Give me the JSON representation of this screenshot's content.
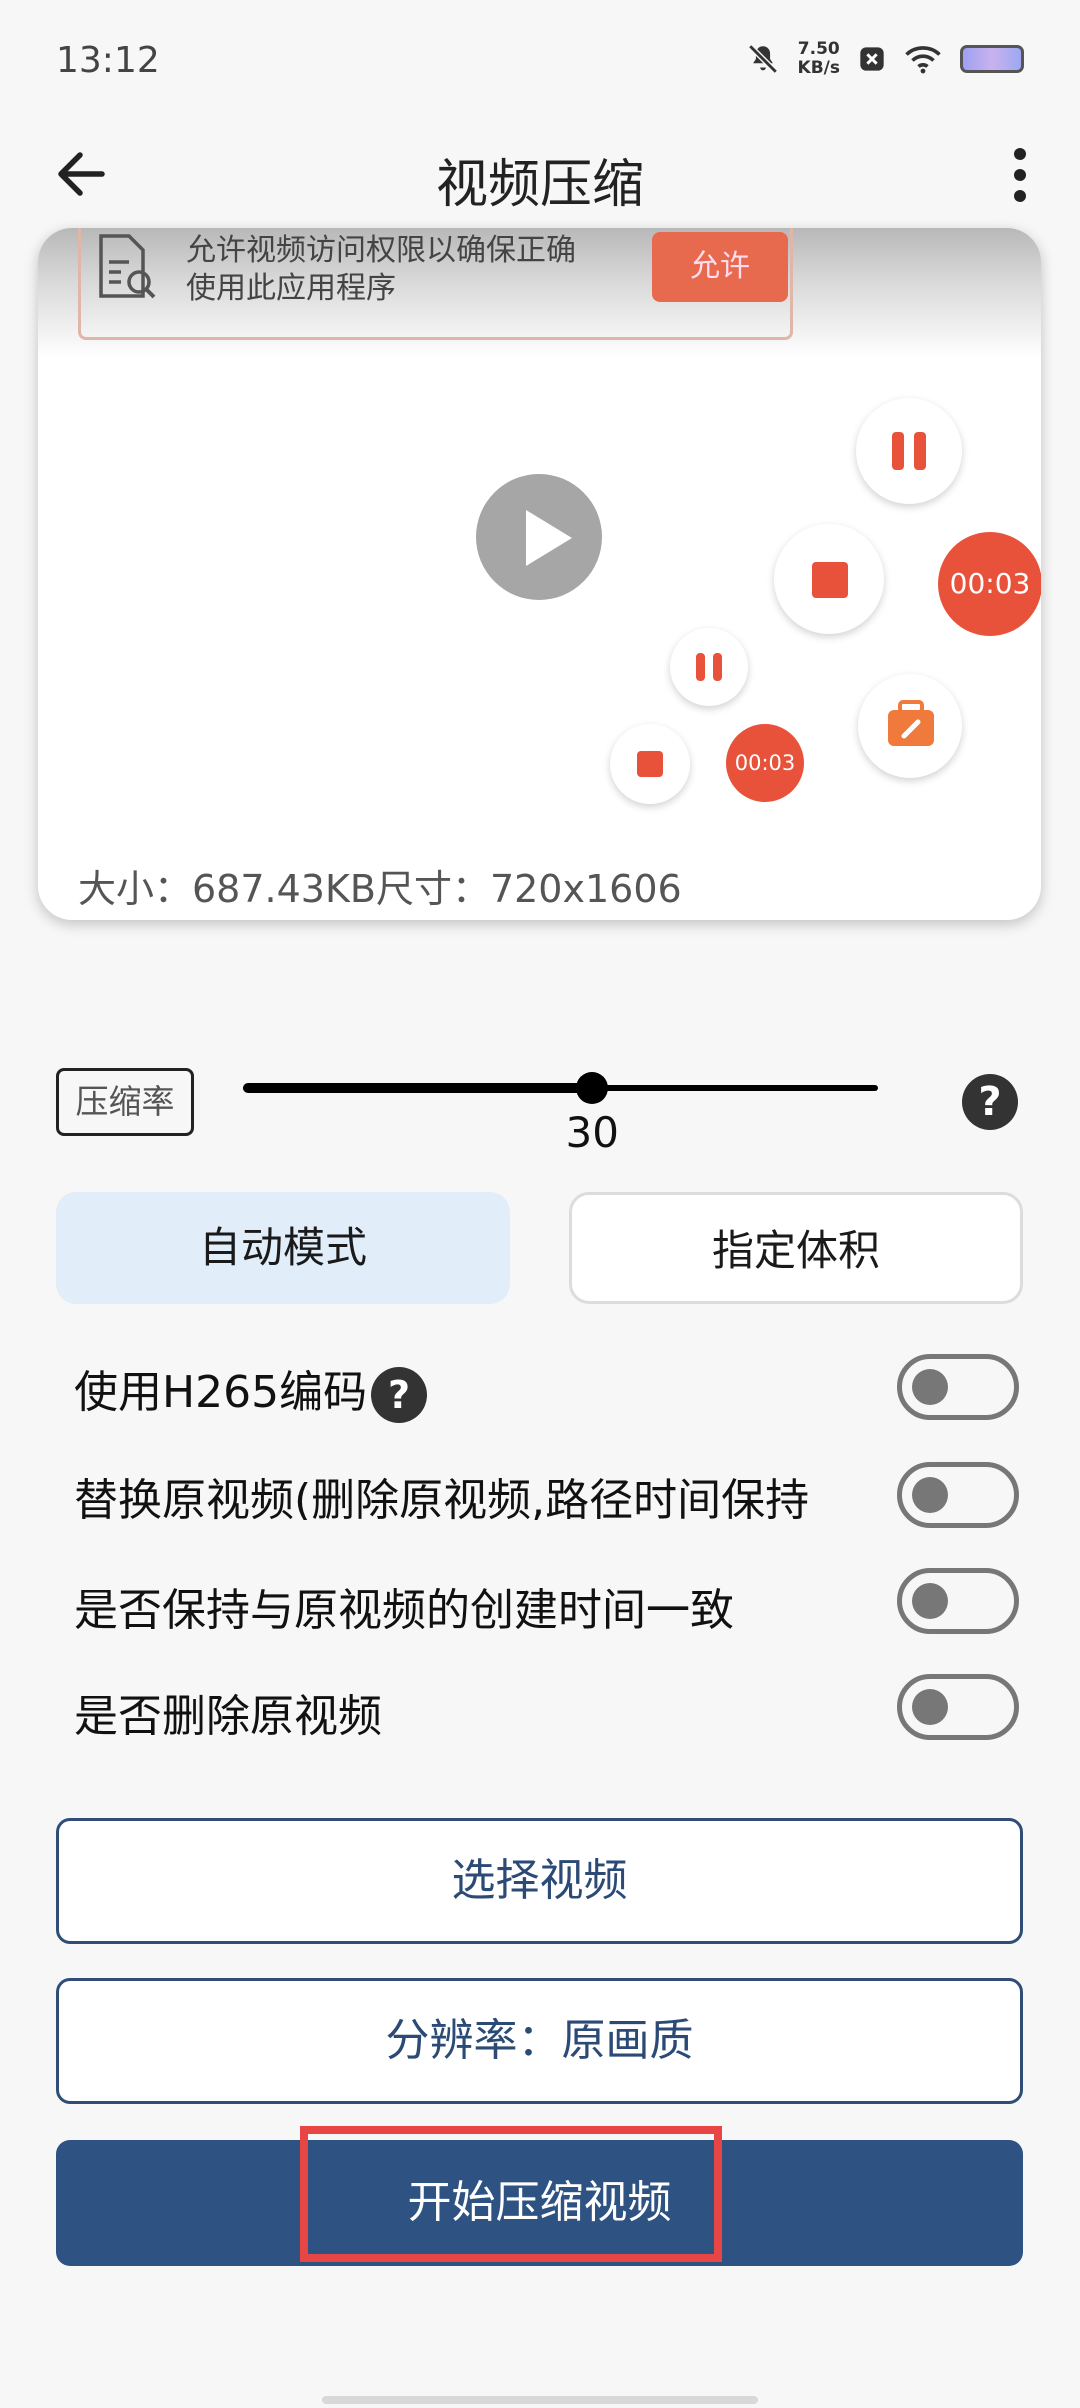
{
  "status_bar": {
    "time": "13:12",
    "net_speed_value": "7.50",
    "net_speed_unit": "KB/s"
  },
  "app_bar": {
    "title": "视频压缩"
  },
  "video_card": {
    "banner": {
      "line1": "允许视频访问权限以确保正确",
      "line2": "使用此应用程序",
      "button": "允许"
    },
    "timer_large": "00:03",
    "timer_small": "00:03",
    "size_info": "大小：687.43KB尺寸：720x1606"
  },
  "compression": {
    "label": "压缩率",
    "value": "30",
    "fraction": 0.55,
    "help": "?"
  },
  "modes": {
    "auto": "自动模式",
    "size": "指定体积",
    "selected": "auto"
  },
  "options": [
    {
      "label": "使用H265编码",
      "has_help": true,
      "enabled": false
    },
    {
      "label": "替换原视频(删除原视频,路径时间保持",
      "enabled": false
    },
    {
      "label": "是否保持与原视频的创建时间一致",
      "enabled": false
    },
    {
      "label": "是否删除原视频",
      "enabled": false
    }
  ],
  "buttons": {
    "select_video": "选择视频",
    "resolution": "分辨率：原画质",
    "start": "开始压缩视频"
  },
  "colors": {
    "primary": "#2e5282",
    "accent_red": "#e8523b",
    "selected_mode_bg": "#e1edf8",
    "highlight_border": "#e84545"
  }
}
